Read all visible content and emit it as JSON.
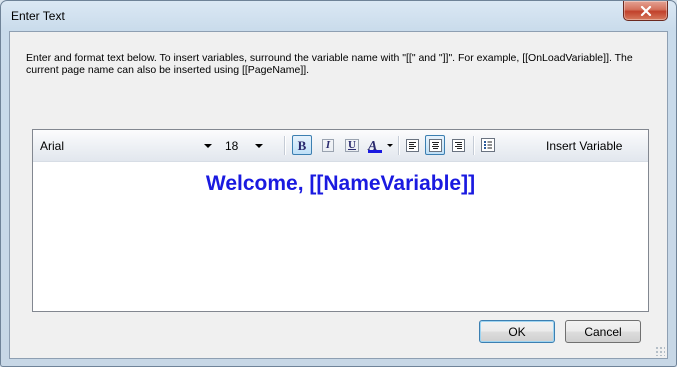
{
  "window": {
    "title": "Enter Text"
  },
  "instructions": "Enter and format text below. To insert variables, surround the variable name with \"[[\" and \"]]\". For example, [[OnLoadVariable]]. The current page name can also be inserted using [[PageName]].",
  "toolbar": {
    "font": "Arial",
    "size": "18",
    "bold_label": "B",
    "italic_label": "I",
    "underline_label": "U",
    "font_color_label": "A",
    "insert_variable_label": "Insert Variable",
    "bold_active": true,
    "align_center_active": true,
    "font_color": "#1a1ae0"
  },
  "editor": {
    "text": "Welcome, [[NameVariable]]",
    "text_color": "#1a1ae0"
  },
  "buttons": {
    "ok": "OK",
    "cancel": "Cancel"
  },
  "icons": {
    "close": "close-icon",
    "align_left": "align-left-icon",
    "align_center": "align-center-icon",
    "align_right": "align-right-icon",
    "insert_variable": "list-icon"
  }
}
